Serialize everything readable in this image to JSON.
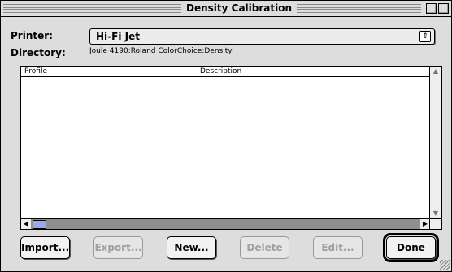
{
  "window": {
    "title": "Density Calibration"
  },
  "printer": {
    "label": "Printer:",
    "value": "Hi-Fi Jet"
  },
  "directory": {
    "label": "Directory:",
    "value": "Joule 4190:Roland ColorChoice:Density:"
  },
  "list": {
    "columns": [
      "Profile",
      "Description"
    ],
    "rows": []
  },
  "buttons": {
    "import": "Import...",
    "export": "Export...",
    "new": "New...",
    "delete": "Delete",
    "edit": "Edit...",
    "done": "Done"
  }
}
